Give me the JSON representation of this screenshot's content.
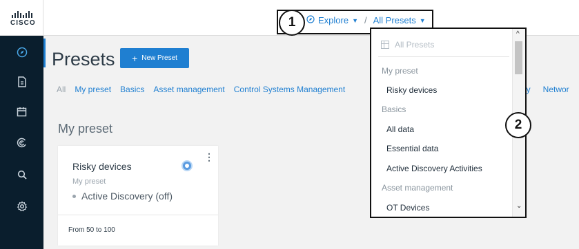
{
  "brand": {
    "logo_text": "CISCO"
  },
  "sidebar": {
    "icons": [
      "compass-icon",
      "document-icon",
      "calendar-icon",
      "radar-icon",
      "search-icon",
      "settings-icon"
    ]
  },
  "breadcrumb": {
    "explore_label": "Explore",
    "separator": "/",
    "presets_label": "All Presets"
  },
  "callouts": {
    "first": "1",
    "second": "2"
  },
  "page": {
    "title": "Presets",
    "new_button_label": "New Preset",
    "filters": [
      "All",
      "My preset",
      "Basics",
      "Asset management",
      "Control Systems Management"
    ],
    "filters_right": [
      "urity",
      "Networ"
    ],
    "section_title": "My preset"
  },
  "card": {
    "title": "Risky devices",
    "subtitle": "My preset",
    "status": "Active Discovery (off)",
    "footer": "From 50 to 100"
  },
  "dropdown": {
    "search_placeholder": "All Presets",
    "items": [
      {
        "type": "group",
        "label": "My preset"
      },
      {
        "type": "opt",
        "label": "Risky devices"
      },
      {
        "type": "group",
        "label": "Basics"
      },
      {
        "type": "opt",
        "label": "All data"
      },
      {
        "type": "opt",
        "label": "Essential data"
      },
      {
        "type": "opt",
        "label": "Active Discovery Activities"
      },
      {
        "type": "group",
        "label": "Asset management"
      },
      {
        "type": "opt",
        "label": "OT Devices"
      }
    ]
  },
  "colors": {
    "accent": "#1f7fd1",
    "sidebar": "#0a1e2d"
  }
}
